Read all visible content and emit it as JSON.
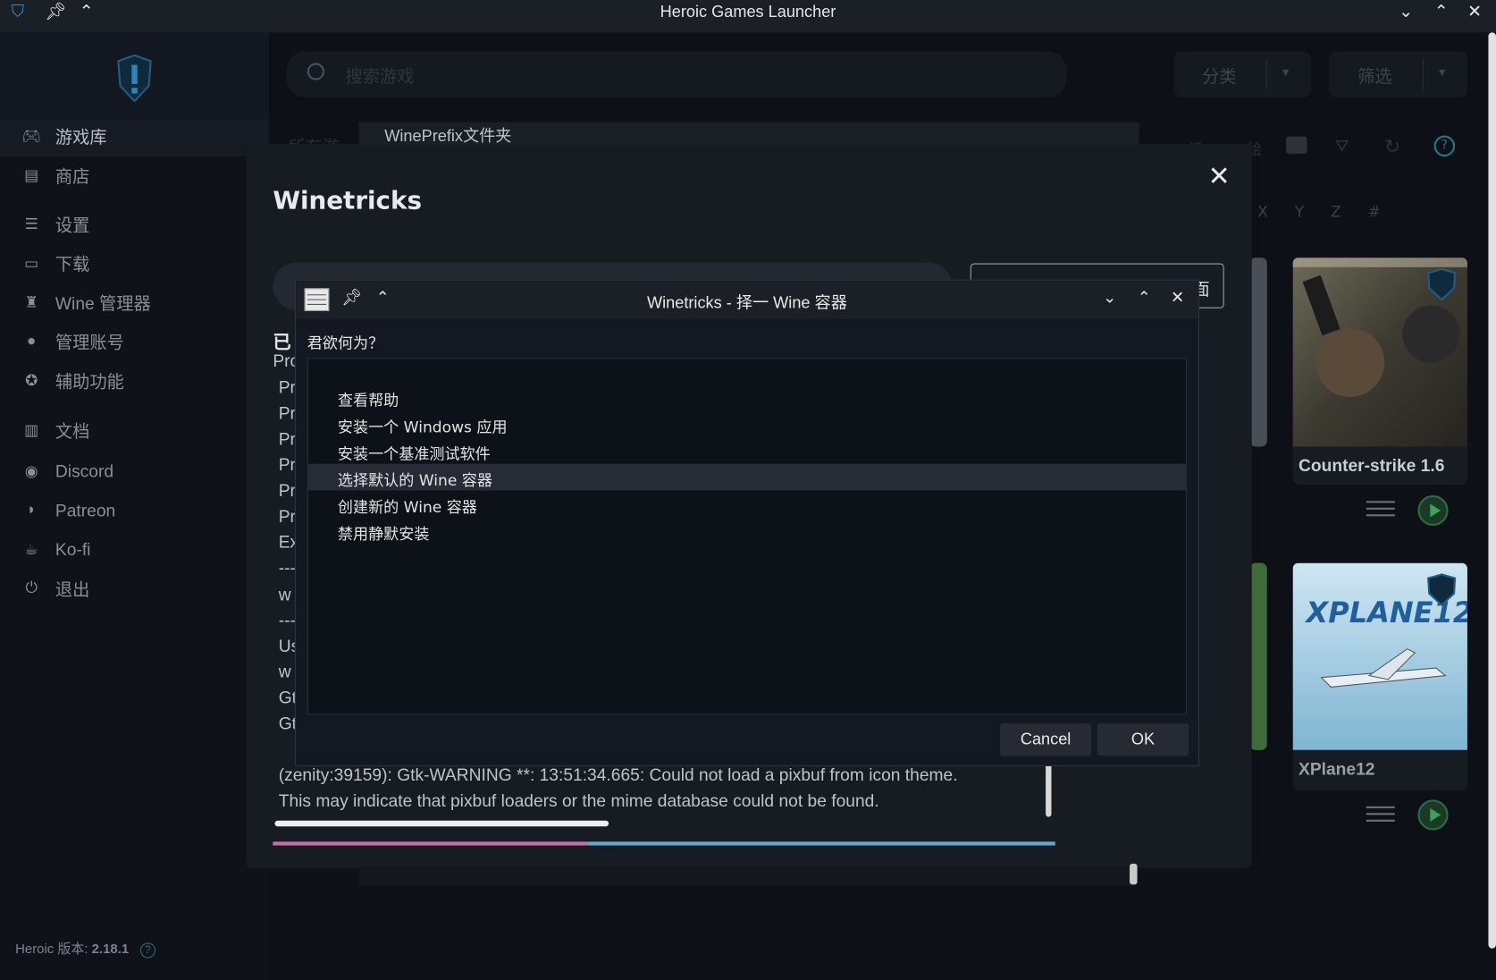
{
  "window": {
    "title": "Heroic Games Launcher"
  },
  "sidebar": {
    "items": [
      {
        "label": "游戏库",
        "icon": "gamepad-icon"
      },
      {
        "label": "商店",
        "icon": "store-icon"
      },
      {
        "label": "设置",
        "icon": "sliders-icon"
      },
      {
        "label": "下载",
        "icon": "download-icon"
      },
      {
        "label": "Wine 管理器",
        "icon": "wine-icon"
      },
      {
        "label": "管理账号",
        "icon": "user-icon"
      },
      {
        "label": "辅助功能",
        "icon": "accessibility-icon"
      },
      {
        "label": "文档",
        "icon": "book-icon"
      },
      {
        "label": "Discord",
        "icon": "discord-icon"
      },
      {
        "label": "Patreon",
        "icon": "patreon-icon"
      },
      {
        "label": "Ko-fi",
        "icon": "kofi-icon"
      },
      {
        "label": "退出",
        "icon": "power-icon"
      }
    ],
    "version_label": "Heroic 版本: ",
    "version_value": "2.18.1"
  },
  "header": {
    "search_placeholder": "搜索游戏",
    "category_label": "分类",
    "filter_label": "筛选",
    "alphabet": [
      "X",
      "Y",
      "Z",
      "#"
    ]
  },
  "games": [
    {
      "title": "Counter-strike 1.6"
    },
    {
      "title": "XPlane12"
    }
  ],
  "background": {
    "wineprefix_label": "WinePrefix文件夹"
  },
  "modal": {
    "title": "Winetricks",
    "button_partial": "面",
    "log_partial": [
      "已",
      "Pro",
      "Pr",
      "Pr",
      "Pr",
      "Pr",
      "Pr",
      "Pr",
      "Ex",
      "---",
      "w",
      "---",
      "Us",
      "w",
      "Gt",
      "Gt"
    ],
    "log_lines": [
      "(zenity:39159): Gtk-WARNING **: 13:51:34.665: Could not load a pixbuf from icon theme.",
      "This may indicate that pixbuf loaders or the mime database could not be found."
    ]
  },
  "zenity": {
    "title": "Winetricks - 择一 Wine 容器",
    "prompt": "君欲何为？",
    "options": [
      "查看帮助",
      "安装一个 Windows 应用",
      "安装一个基准测试软件",
      "选择默认的 Wine 容器",
      "创建新的 Wine 容器",
      "禁用静默安装"
    ],
    "selected_index": 3,
    "cancel_label": "Cancel",
    "ok_label": "OK"
  }
}
